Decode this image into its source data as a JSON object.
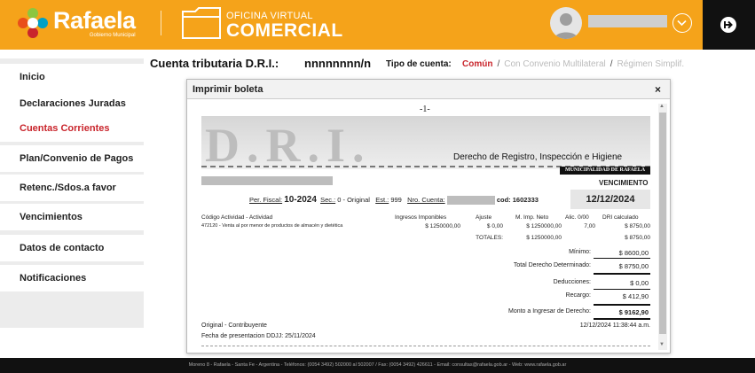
{
  "header": {
    "logo_name": "Rafaela",
    "logo_subtitle": "Gobierno Municipal",
    "app_title_top": "OFICINA VIRTUAL",
    "app_title_bottom": "COMERCIAL",
    "brand_color": "#f5a31a"
  },
  "sidebar": {
    "items": [
      {
        "label": "Inicio"
      },
      {
        "label": "Declaraciones Juradas"
      },
      {
        "label": "Cuentas Corrientes",
        "active": true
      },
      {
        "label": "Plan/Convenio de Pagos"
      },
      {
        "label": "Retenc./Sdos.a favor"
      },
      {
        "label": "Vencimientos"
      },
      {
        "label": "Datos de contacto"
      },
      {
        "label": "Notificaciones"
      }
    ],
    "active_color": "#c9252c"
  },
  "account": {
    "title": "Cuenta tributaria D.R.I.:",
    "number": "nnnnnnnn/n",
    "tipo_label": "Tipo de cuenta:",
    "tipo_options": [
      "Común",
      "Con Convenio Multilateral",
      "Régimen Simplif."
    ],
    "separator": "/"
  },
  "modal": {
    "title": "Imprimir boleta",
    "close": "×"
  },
  "boleta": {
    "page_marker": "-1-",
    "banner_text": "D.R.I.",
    "subtitle": "Derecho de Registro, Inspección e Higiene",
    "municipality": "MUNICIPALIDAD DE RAFAELA",
    "vencimiento_label": "VENCIMIENTO",
    "vencimiento_date": "12/12/2024",
    "per_fiscal_label": "Per. Fiscal:",
    "per_fiscal_value": "10-2024",
    "sec_label": "Sec.:",
    "sec_value": "0 - Original",
    "est_label": "Est.:",
    "est_value": "999",
    "nro_cuenta_label": "Nro. Cuenta:",
    "cod_label": "cod:",
    "cod_value": "1602333",
    "columns": {
      "actividad": "Código Actividad - Actividad",
      "ingresos": "Ingresos Imponibles",
      "ajuste": "Ajuste",
      "m_imp": "M. Imp. Neto",
      "alic": "Alic. 0/00",
      "dri": "DRI calculado"
    },
    "row": {
      "actividad": "472120 - Venta al por menor de productos de almacén y dietética",
      "ingresos": "$ 1250000,00",
      "ajuste": "$ 0,00",
      "m_imp": "$ 1250000,00",
      "alic": "7,00",
      "dri": "$ 8750,00"
    },
    "totales": {
      "label": "TOTALES:",
      "m_imp": "$ 1250000,00",
      "dri": "$ 8750,00"
    },
    "summary": [
      {
        "label": "Mínimo:",
        "value": "$ 8600,00"
      },
      {
        "label": "Total Derecho Determinado:",
        "value": "$ 8750,00"
      },
      {
        "label": "Deducciones:",
        "value": "$ 0,00"
      },
      {
        "label": "Recargo:",
        "value": "$ 412,90"
      },
      {
        "label": "Monto a Ingresar de Derecho:",
        "value": "$ 9162,90"
      }
    ],
    "copy_label": "Original - Contribuyente",
    "presentation": "Fecha de presentacion DDJJ: 25/11/2024",
    "timestamp": "12/12/2024 11:38:44 a.m."
  },
  "footer": {
    "text": "Moreno 8 - Rafaela - Santa Fe - Argentina - Teléfonos: (0054 3492) 502000 al 502007 / Fax: (0054 3492) 426611 - Email: consultas@rafaela.gob.ar - Web: www.rafaela.gob.ar"
  }
}
